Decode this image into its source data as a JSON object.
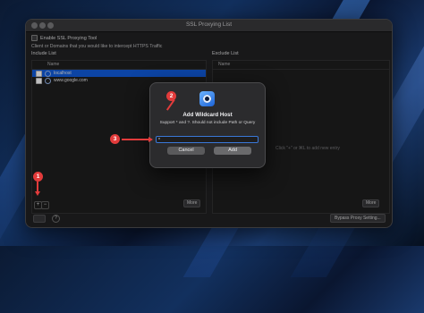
{
  "window": {
    "title": "SSL Proxying List",
    "enable_label": "Enable SSL Proxying Tool",
    "description": "Client or Domains that you would like to intercept HTTPS Traffic"
  },
  "include_list": {
    "label": "Include List",
    "column_header": "Name",
    "rows": [
      {
        "name": "localhost",
        "checked": true,
        "selected": true
      },
      {
        "name": "www.google.com",
        "checked": true,
        "selected": false
      }
    ],
    "more_label": "More",
    "add_label": "+",
    "remove_label": "−"
  },
  "exclude_list": {
    "label": "Exclude List",
    "column_header": "Name",
    "empty_hint": "Click \"+\" or ⌘L to add new entry",
    "more_label": "More"
  },
  "footer": {
    "help_label": "?",
    "bypass_label": "Bypass Proxy Setting..."
  },
  "dialog": {
    "title": "Add Wildcard Host",
    "subtitle": "Support * and ?. Should not include Path or Query",
    "input_value": "*",
    "cancel_label": "Cancel",
    "add_label": "Add"
  },
  "annotations": [
    "1",
    "2",
    "3"
  ],
  "colors": {
    "accent": "#0f54c9",
    "annotation": "#e23b3b",
    "window_bg": "#1e1e1f"
  }
}
